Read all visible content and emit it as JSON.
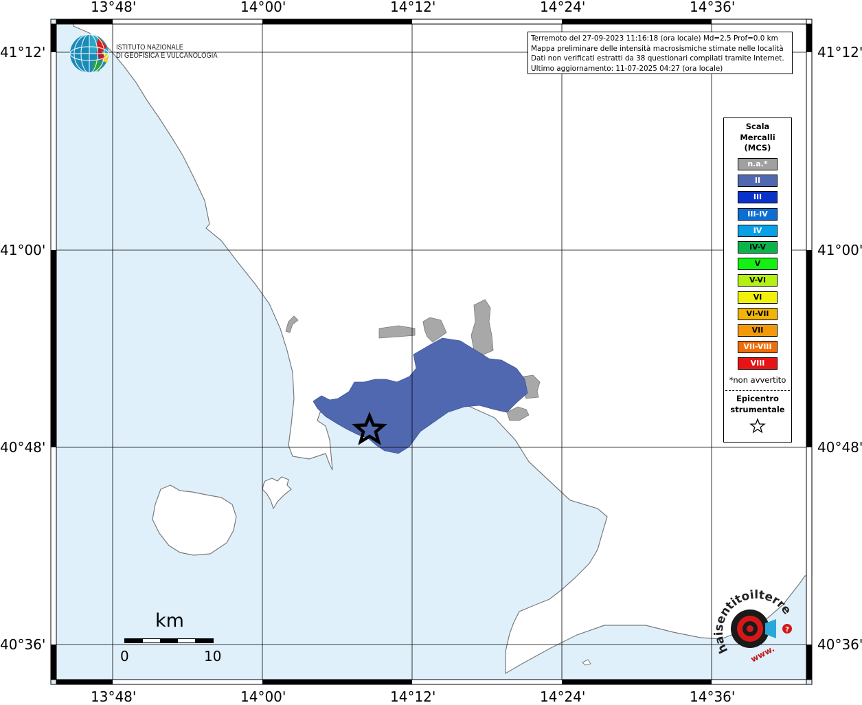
{
  "map": {
    "lon_labels": [
      "13°48'",
      "14°00'",
      "14°12'",
      "14°24'",
      "14°36'"
    ],
    "lat_labels": [
      "41°12'",
      "41°00'",
      "40°48'",
      "40°36'"
    ],
    "colors": {
      "sea": "#dff0fb",
      "land": "#ffffff",
      "coast": "#7a7a7a",
      "intensity_II": "#5068b0",
      "not_felt": "#a8a8a8",
      "grid": "#000000"
    }
  },
  "info": {
    "line1": "Terremoto del 27-09-2023 11:16:18 (ora locale) Md=2.5 Prof=0.0 km",
    "line2": "Mappa preliminare delle intensità macrosismiche stimate nelle località",
    "line3": "Dati non verificati estratti da 38 questionari compilati tramite Internet.",
    "line4": "Ultimo aggiornamento: 11-07-2025 04:27 (ora locale)"
  },
  "legend": {
    "title_line1": "Scala",
    "title_line2": "Mercalli",
    "title_line3": "(MCS)",
    "items": [
      {
        "label": "n.a.*",
        "color": "#a0a0a0"
      },
      {
        "label": "II",
        "color": "#5068b0"
      },
      {
        "label": "III",
        "color": "#0a32c8"
      },
      {
        "label": "III-IV",
        "color": "#0a6ed2"
      },
      {
        "label": "IV",
        "color": "#0aa0e6"
      },
      {
        "label": "IV-V",
        "color": "#0ab44b"
      },
      {
        "label": "V",
        "color": "#14f014"
      },
      {
        "label": "V-VI",
        "color": "#b4f014"
      },
      {
        "label": "VI",
        "color": "#f0f00a"
      },
      {
        "label": "VI-VII",
        "color": "#f0b40a"
      },
      {
        "label": "VII",
        "color": "#f09a0a"
      },
      {
        "label": "VII-VIII",
        "color": "#f06e0a"
      },
      {
        "label": "VIII",
        "color": "#e61414"
      }
    ],
    "note": "*non avvertito",
    "epicenter_line1": "Epicentro",
    "epicenter_line2": "strumentale"
  },
  "logo": {
    "line1": "ISTITUTO NAZIONALE",
    "line2": "DI GEOFISICA E VULCANOLOGIA"
  },
  "scalebar": {
    "unit": "km",
    "start": "0",
    "end": "10"
  },
  "badge": {
    "text": "haisentitoilterremoto.it",
    "prefix": "www."
  }
}
